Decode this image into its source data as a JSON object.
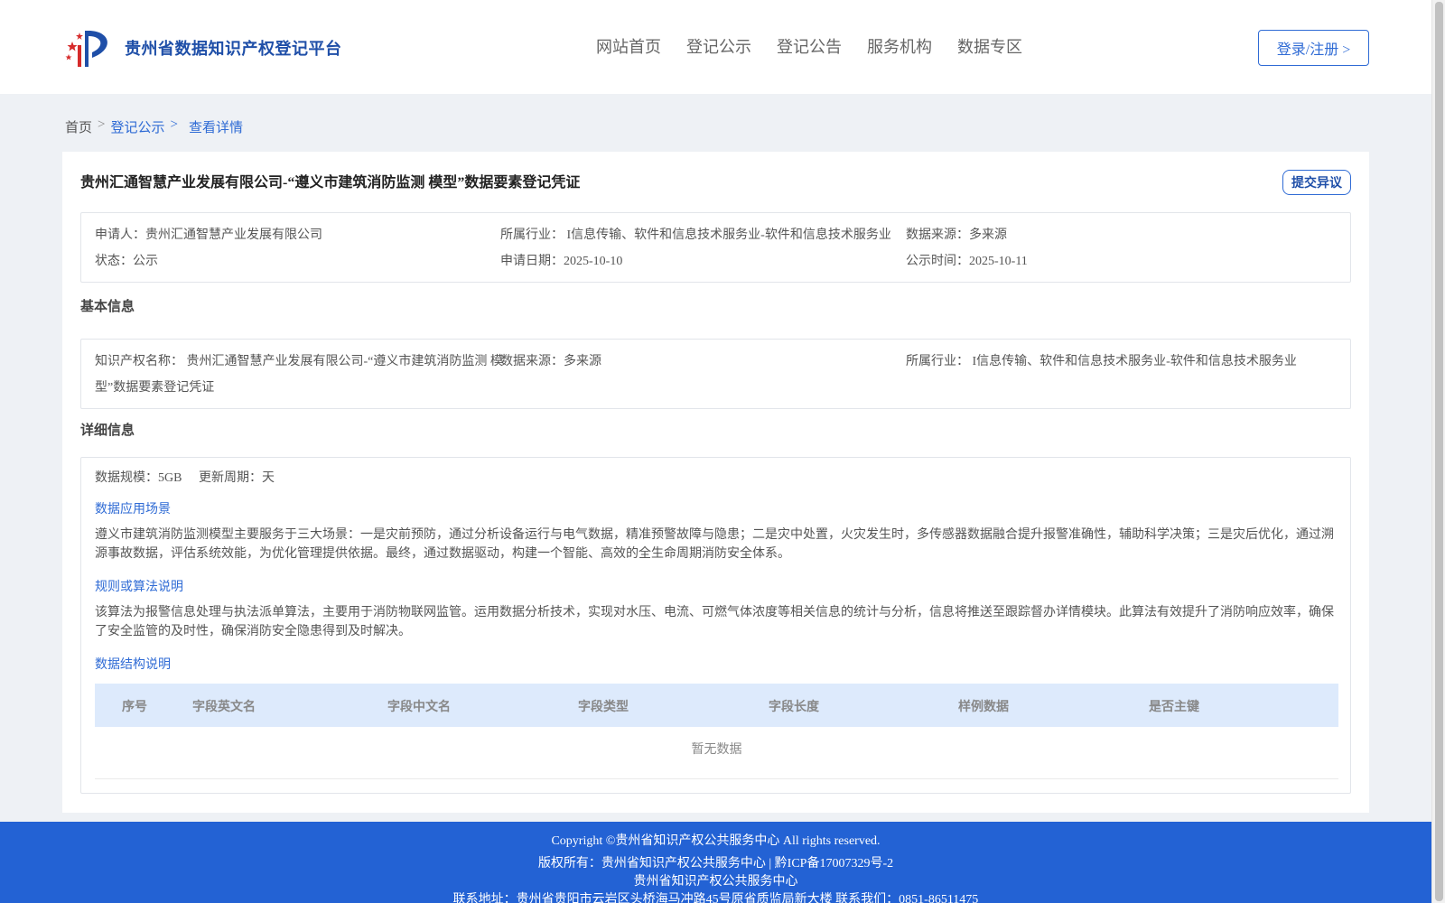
{
  "header": {
    "site_title": "贵州省数据知识产权登记平台",
    "nav": [
      "网站首页",
      "登记公示",
      "登记公告",
      "服务机构",
      "数据专区"
    ],
    "login_label": "登录/注册 >"
  },
  "breadcrumb": {
    "home": "首页",
    "sep": ">",
    "items": [
      "登记公示",
      "查看详情"
    ]
  },
  "detail": {
    "title": "贵州汇通智慧产业发展有限公司-“遵义市建筑消防监测 模型”数据要素登记凭证",
    "objection_label": "提交异议",
    "summary": {
      "applicant_label": "申请人：",
      "applicant": "贵州汇通智慧产业发展有限公司",
      "industry_label": "所属行业：",
      "industry": "I信息传输、软件和信息技术服务业-软件和信息技术服务业",
      "source_label": "数据来源：",
      "source": "多来源",
      "status_label": "状态：",
      "status": "公示",
      "apply_date_label": "申请日期：",
      "apply_date": "2025-10-10",
      "publish_date_label": "公示时间：",
      "publish_date": "2025-10-11"
    },
    "basic_title": "基本信息",
    "basic": {
      "ip_name_label": "知识产权名称：",
      "ip_name_line1": "贵州汇通智慧产业发展有限公司-“遵义市建筑消防监测 模",
      "ip_name_line2": "型”数据要素登记凭证",
      "source_label": "数据来源：",
      "source": "多来源",
      "industry_label": "所属行业：",
      "industry": "I信息传输、软件和信息技术服务业-软件和信息技术服务业"
    },
    "detail_title": "详细信息",
    "detail_info": {
      "scale_label": "数据规模：",
      "scale": "5GB",
      "cycle_label": "更新周期：",
      "cycle": "天",
      "scenario_title": "数据应用场景",
      "scenario_text": "遵义市建筑消防监测模型主要服务于三大场景：一是灾前预防，通过分析设备运行与电气数据，精准预警故障与隐患；二是灾中处置，火灾发生时，多传感器数据融合提升报警准确性，辅助科学决策；三是灾后优化，通过溯源事故数据，评估系统效能，为优化管理提供依据。最终，通过数据驱动，构建一个智能、高效的全生命周期消防安全体系。",
      "algo_title": "规则或算法说明",
      "algo_text": "该算法为报警信息处理与执法派单算法，主要用于消防物联网监管。运用数据分析技术，实现对水压、电流、可燃气体浓度等相关信息的统计与分析，信息将推送至跟踪督办详情模块。此算法有效提升了消防响应效率，确保了安全监管的及时性，确保消防安全隐患得到及时解决。",
      "structure_title": "数据结构说明",
      "table_headers": [
        "序号",
        "字段英文名",
        "字段中文名",
        "字段类型",
        "字段长度",
        "样例数据",
        "是否主键"
      ],
      "empty_text": "暂无数据"
    }
  },
  "footer": {
    "line1": "Copyright ©贵州省知识产权公共服务中心 All rights reserved.",
    "line2": "版权所有：贵州省知识产权公共服务中心 | 黔ICP备17007329号-2",
    "line3": "贵州省知识产权公共服务中心",
    "line4": "联系地址：贵州省贵阳市云岩区头桥海马冲路45号原省质监局新大楼 联系我们：0851-86511475"
  },
  "colors": {
    "brand_blue": "#2f6bd5",
    "footer_blue": "#2362d4",
    "table_head": "#ddeafc"
  }
}
